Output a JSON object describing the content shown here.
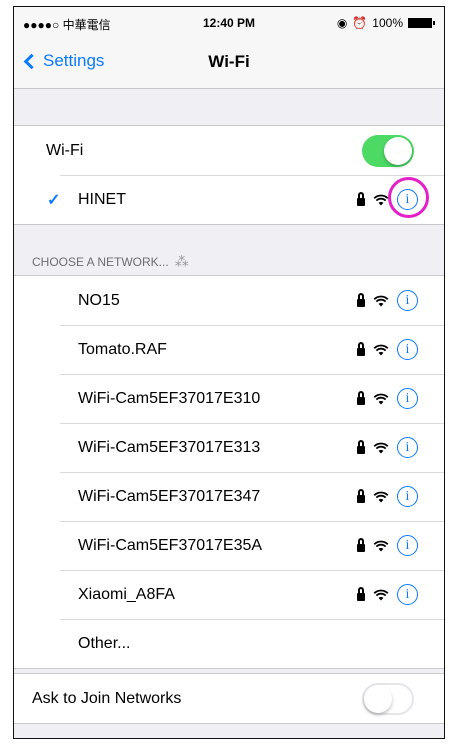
{
  "status_bar": {
    "carrier": "●●●●○ 中華電信",
    "time": "12:40 PM",
    "battery": "100%"
  },
  "nav": {
    "back_label": "Settings",
    "title": "Wi-Fi"
  },
  "wifi_toggle": {
    "label": "Wi-Fi",
    "state": "on"
  },
  "connected": {
    "name": "HINET",
    "check": "✓"
  },
  "section": {
    "choose_label": "CHOOSE A NETWORK..."
  },
  "networks": [
    {
      "name": "NO15"
    },
    {
      "name": "Tomato.RAF"
    },
    {
      "name": "WiFi-Cam5EF37017E310"
    },
    {
      "name": "WiFi-Cam5EF37017E313"
    },
    {
      "name": "WiFi-Cam5EF37017E347"
    },
    {
      "name": "WiFi-Cam5EF37017E35A"
    },
    {
      "name": "Xiaomi_A8FA"
    }
  ],
  "other_label": "Other...",
  "ask_to_join": {
    "label": "Ask to Join Networks",
    "state": "off"
  },
  "icons": {
    "info_glyph": "i",
    "spinner_glyph": "⁂"
  },
  "colors": {
    "accent": "#0a7aff",
    "toggle_on": "#4cd964",
    "highlight": "#e620c8"
  }
}
